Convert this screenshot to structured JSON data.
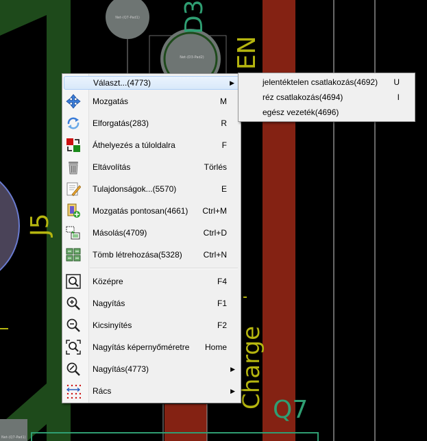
{
  "pcb": {
    "pad_label_top": "Net-(Q7-Pad1)",
    "pad_label_d3": "Net-(D3-Pad2)",
    "silkscreen_d3": "D3",
    "silkscreen_en": "EN",
    "silkscreen_j5": "J5",
    "silkscreen_charge": "Charge",
    "silkscreen_q7": "Q7",
    "pad_label_bottom": "Net-(Q7-Pad1)"
  },
  "context_menu": {
    "items": [
      {
        "label": "Választ...(4773)",
        "shortcut": "",
        "submenu": true,
        "icon": "none",
        "highlighted": true
      },
      {
        "label": "Mozgatás",
        "shortcut": "M",
        "icon": "move-arrows-icon"
      },
      {
        "label": "Elforgatás(283)",
        "shortcut": "R",
        "icon": "rotate-icon"
      },
      {
        "label": "Áthelyezés a túloldalra",
        "shortcut": "F",
        "icon": "flip-board-icon"
      },
      {
        "label": "Eltávolítás",
        "shortcut": "Törlés",
        "icon": "trash-icon"
      },
      {
        "label": "Tulajdonságok...(5570)",
        "shortcut": "E",
        "icon": "properties-edit-icon"
      },
      {
        "label": "Mozgatás pontosan(4661)",
        "shortcut": "Ctrl+M",
        "icon": "move-exact-icon"
      },
      {
        "label": "Másolás(4709)",
        "shortcut": "Ctrl+D",
        "icon": "duplicate-icon"
      },
      {
        "label": "Tömb létrehozása(5328)",
        "shortcut": "Ctrl+N",
        "icon": "array-create-icon"
      },
      {
        "label": "Középre",
        "shortcut": "F4",
        "icon": "zoom-center-icon"
      },
      {
        "label": "Nagyítás",
        "shortcut": "F1",
        "icon": "zoom-in-icon"
      },
      {
        "label": "Kicsinyítés",
        "shortcut": "F2",
        "icon": "zoom-out-icon"
      },
      {
        "label": "Nagyítás képernyőméretre",
        "shortcut": "Home",
        "icon": "zoom-fit-icon"
      },
      {
        "label": "Nagyítás(4773)",
        "shortcut": "",
        "submenu": true,
        "icon": "zoom-submenu-icon"
      },
      {
        "label": "Rács",
        "shortcut": "",
        "submenu": true,
        "icon": "grid-icon"
      }
    ]
  },
  "submenu": {
    "items": [
      {
        "label": "jelentéktelen csatlakozás(4692)",
        "shortcut": "U"
      },
      {
        "label": "réz csatlakozás(4694)",
        "shortcut": "I"
      },
      {
        "label": "egész vezeték(4696)",
        "shortcut": ""
      }
    ]
  },
  "colors": {
    "menu_bg": "#f0f0f0",
    "highlight": "#d9e9fa",
    "track_red": "#842213",
    "copper_green": "#1e4a1b",
    "silkscreen_yellow": "#b5b50f",
    "silkscreen_green": "#2f9e72"
  }
}
